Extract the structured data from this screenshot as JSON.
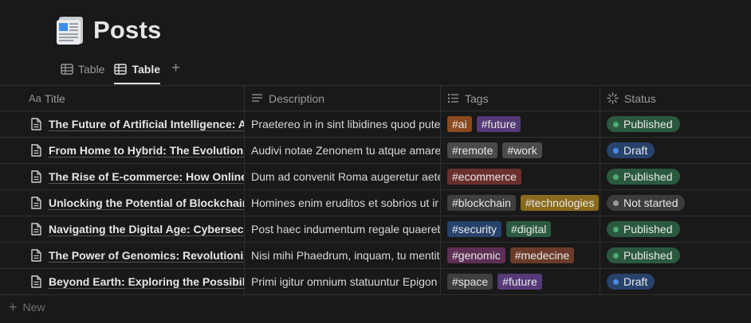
{
  "page": {
    "title": "Posts"
  },
  "tabs": [
    {
      "label": "Table",
      "active": false
    },
    {
      "label": "Table",
      "active": true
    }
  ],
  "add_tab": "+",
  "columns": [
    {
      "label": "Title",
      "prefix": "Aa",
      "icon": "text-type-icon"
    },
    {
      "label": "Description",
      "icon": "lines-icon"
    },
    {
      "label": "Tags",
      "icon": "list-icon"
    },
    {
      "label": "Status",
      "icon": "loader-icon"
    }
  ],
  "rows": [
    {
      "title": "The Future of Artificial Intelligence: Adv",
      "description": "Praetereo in in sint libidines quod pute",
      "tags": [
        {
          "label": "#ai",
          "color": "#8a4a1d"
        },
        {
          "label": "#future",
          "color": "#553a77"
        }
      ],
      "status": {
        "label": "Published",
        "color": "#2b593f",
        "dot": "#4fa871"
      }
    },
    {
      "title": "From Home to Hybrid: The Evolution of",
      "description": "Audivi notae Zenonem tu atque amare",
      "tags": [
        {
          "label": "#remote",
          "color": "#4a4a4a"
        },
        {
          "label": "#work",
          "color": "#4a4a4a"
        }
      ],
      "status": {
        "label": "Draft",
        "color": "#27426b",
        "dot": "#4a8be0"
      }
    },
    {
      "title": "The Rise of E-commerce: How Online S",
      "description": "Dum ad convenit Roma augeretur aete",
      "tags": [
        {
          "label": "#ecommerce",
          "color": "#6b2f2f"
        }
      ],
      "status": {
        "label": "Published",
        "color": "#2b593f",
        "dot": "#4fa871"
      }
    },
    {
      "title": "Unlocking the Potential of Blockchain T",
      "description": "Homines enim eruditos et sobrios ut ir",
      "tags": [
        {
          "label": "#blockchain",
          "color": "#3f3f3f"
        },
        {
          "label": "#technologies",
          "color": "#8a6a1d"
        }
      ],
      "status": {
        "label": "Not started",
        "color": "#3c3c3c",
        "dot": "#9b9b9b"
      }
    },
    {
      "title": "Navigating the Digital Age: Cybersecur",
      "description": "Post haec indumentum regale quaereb",
      "tags": [
        {
          "label": "#security",
          "color": "#27426b"
        },
        {
          "label": "#digital",
          "color": "#2b593f"
        }
      ],
      "status": {
        "label": "Published",
        "color": "#2b593f",
        "dot": "#4fa871"
      }
    },
    {
      "title": "The Power of Genomics: Revolutionizin",
      "description": "Nisi mihi Phaedrum, inquam, tu mentit",
      "tags": [
        {
          "label": "#genomic",
          "color": "#5e2f55"
        },
        {
          "label": "#medecine",
          "color": "#6b3b2a"
        }
      ],
      "status": {
        "label": "Published",
        "color": "#2b593f",
        "dot": "#4fa871"
      }
    },
    {
      "title": "Beyond Earth: Exploring the Possibilitie",
      "description": "Primi igitur omnium statuuntur Epigon",
      "tags": [
        {
          "label": "#space",
          "color": "#3f3f3f"
        },
        {
          "label": "#future",
          "color": "#553a77"
        }
      ],
      "status": {
        "label": "Draft",
        "color": "#27426b",
        "dot": "#4a8be0"
      }
    }
  ],
  "new_label": "New"
}
